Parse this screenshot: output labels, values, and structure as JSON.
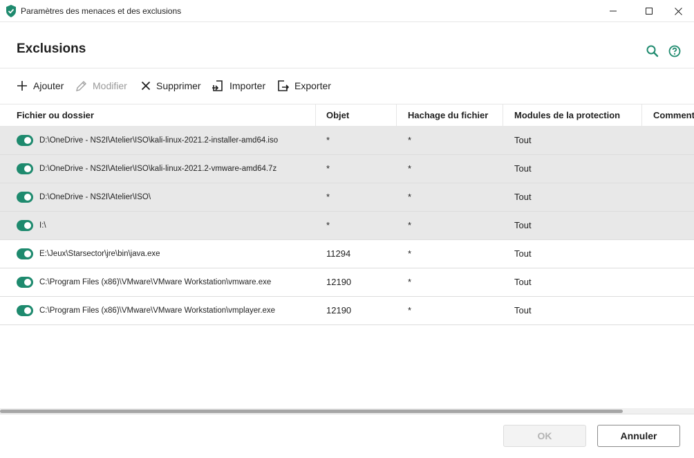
{
  "window": {
    "title": "Paramètres des menaces et des exclusions",
    "controls": [
      "minimize-icon",
      "maximize-icon",
      "close-icon"
    ]
  },
  "header": {
    "title": "Exclusions",
    "icons": [
      "search-icon",
      "help-icon"
    ]
  },
  "toolbar": {
    "add_label": "Ajouter",
    "edit_label": "Modifier",
    "delete_label": "Supprimer",
    "import_label": "Importer",
    "export_label": "Exporter"
  },
  "table": {
    "columns": [
      "Fichier ou dossier",
      "Objet",
      "Hachage du fichier",
      "Modules de la protection",
      "Comment"
    ],
    "rows": [
      {
        "path": "D:\\OneDrive - NS2I\\Atelier\\ISO\\kali-linux-2021.2-installer-amd64.iso",
        "object": "*",
        "hash": "*",
        "modules": "Tout",
        "enabled": true,
        "selected": true
      },
      {
        "path": "D:\\OneDrive - NS2I\\Atelier\\ISO\\kali-linux-2021.2-vmware-amd64.7z",
        "object": "*",
        "hash": "*",
        "modules": "Tout",
        "enabled": true,
        "selected": true
      },
      {
        "path": "D:\\OneDrive - NS2I\\Atelier\\ISO\\",
        "object": "*",
        "hash": "*",
        "modules": "Tout",
        "enabled": true,
        "selected": true
      },
      {
        "path": "I:\\",
        "object": "*",
        "hash": "*",
        "modules": "Tout",
        "enabled": true,
        "selected": true
      },
      {
        "path": "E:\\Jeux\\Starsector\\jre\\bin\\java.exe",
        "object": "11294",
        "hash": "*",
        "modules": "Tout",
        "enabled": true,
        "selected": false
      },
      {
        "path": "C:\\Program Files (x86)\\VMware\\VMware Workstation\\vmware.exe",
        "object": "12190",
        "hash": "*",
        "modules": "Tout",
        "enabled": true,
        "selected": false
      },
      {
        "path": "C:\\Program Files (x86)\\VMware\\VMware Workstation\\vmplayer.exe",
        "object": "12190",
        "hash": "*",
        "modules": "Tout",
        "enabled": true,
        "selected": false
      }
    ]
  },
  "footer": {
    "ok_label": "OK",
    "cancel_label": "Annuler"
  },
  "colors": {
    "accent": "#1e8a6e",
    "selected_row": "#e8e8e8"
  }
}
